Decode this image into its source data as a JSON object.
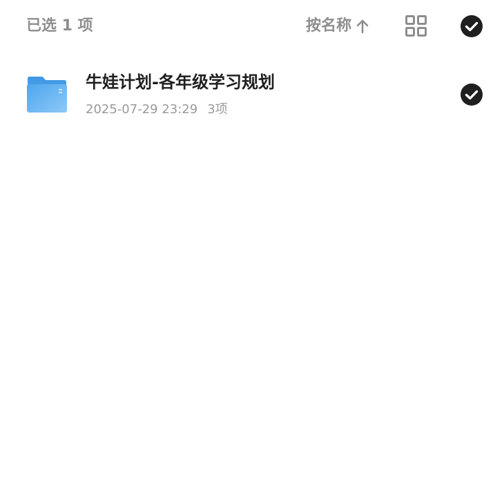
{
  "toolbar": {
    "selected_label": "已选 1 项",
    "sort_label": "按名称",
    "sort_icon": "arrow-up-icon",
    "view_icon": "grid-view-icon",
    "select_all_icon": "check-circle-icon"
  },
  "files": [
    {
      "name": "牛娃计划-各年级学习规划",
      "type_icon": "folder-icon",
      "modified": "2025-07-29 23:29",
      "item_count": "3项",
      "selected": true
    }
  ],
  "colors": {
    "muted_text": "#8e8e8e",
    "primary_text": "#1f1f1f",
    "meta_text": "#9a9a9a",
    "check_fill": "#1f1f1f",
    "folder_blue": "#5aaef0"
  }
}
